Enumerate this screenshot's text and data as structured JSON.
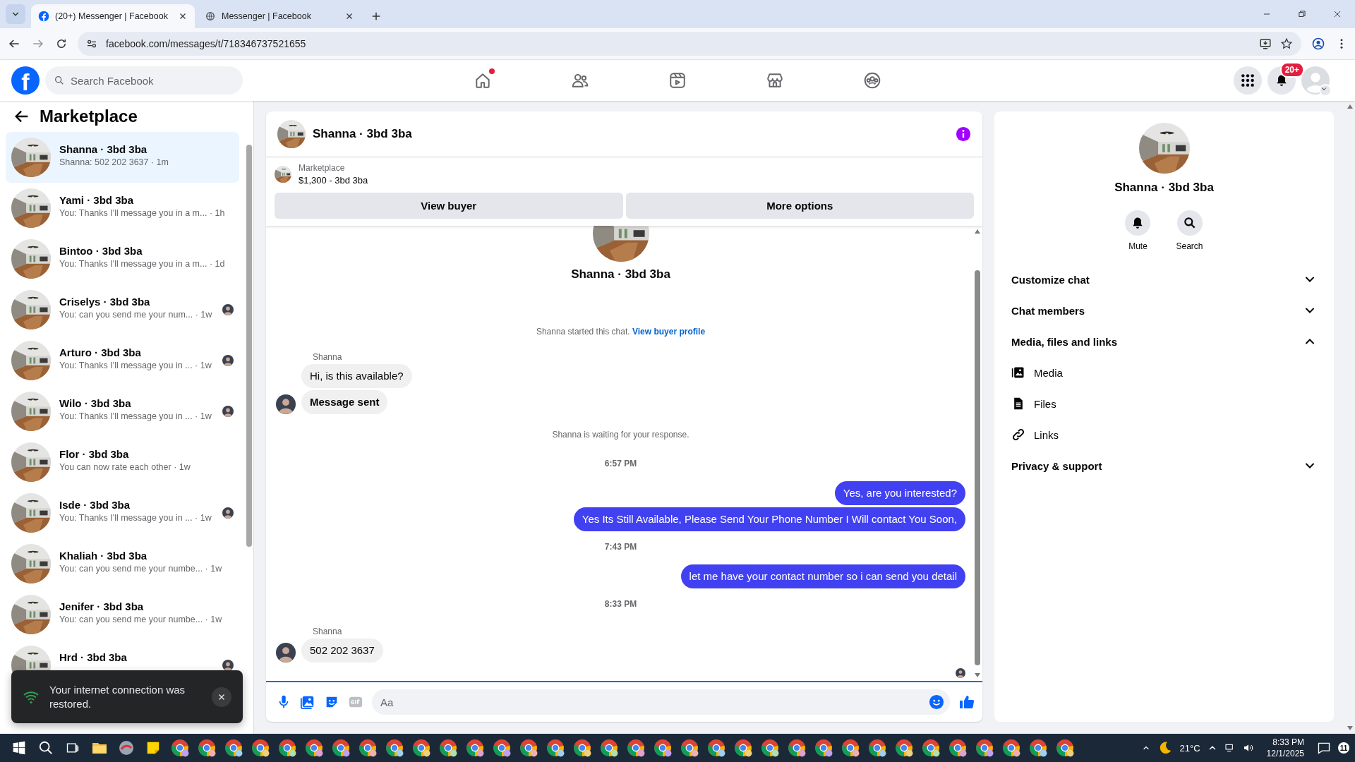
{
  "browser": {
    "tabs": [
      {
        "title": "(20+) Messenger | Facebook",
        "selected": true
      },
      {
        "title": "Messenger | Facebook",
        "selected": false
      }
    ],
    "url": "facebook.com/messages/t/718346737521655"
  },
  "header": {
    "logo": "f",
    "search": {
      "placeholder": "Search Facebook"
    },
    "nav": [
      {
        "kind": "home",
        "unread": true
      },
      {
        "kind": "friends",
        "unread": false
      },
      {
        "kind": "video",
        "unread": false
      },
      {
        "kind": "marketplace",
        "unread": false
      },
      {
        "kind": "groups",
        "unread": false
      }
    ],
    "notification_badge": "20+"
  },
  "sidebar": {
    "title": "Marketplace",
    "conversations": [
      {
        "name": "Shanna · 3bd 3ba",
        "preview": "Shanna: 502 202 3637 · 1m",
        "selected": true,
        "seen": false
      },
      {
        "name": "Yami · 3bd 3ba",
        "preview": "You: Thanks I'll message you in a m... · 1h",
        "selected": false,
        "seen": false
      },
      {
        "name": "Bintoo · 3bd 3ba",
        "preview": "You: Thanks I'll message you in a m... · 1d",
        "selected": false,
        "seen": false
      },
      {
        "name": "Criselys · 3bd 3ba",
        "preview": "You: can you send me your num... · 1w",
        "selected": false,
        "seen": true
      },
      {
        "name": "Arturo · 3bd 3ba",
        "preview": "You: Thanks I'll message you in ... · 1w",
        "selected": false,
        "seen": true
      },
      {
        "name": "Wilo · 3bd 3ba",
        "preview": "You: Thanks I'll message you in ... · 1w",
        "selected": false,
        "seen": true
      },
      {
        "name": "Flor · 3bd 3ba",
        "preview": "You can now rate each other · 1w",
        "selected": false,
        "seen": false
      },
      {
        "name": "Isde · 3bd 3ba",
        "preview": "You: Thanks I'll message you in ... · 1w",
        "selected": false,
        "seen": true
      },
      {
        "name": "Khaliah · 3bd 3ba",
        "preview": "You: can you send me your numbe... · 1w",
        "selected": false,
        "seen": false
      },
      {
        "name": "Jenifer · 3bd 3ba",
        "preview": "You: can you send me your numbe... · 1w",
        "selected": false,
        "seen": false
      },
      {
        "name": "Hrd · 3bd 3ba",
        "selected": false,
        "seen": true
      }
    ]
  },
  "toast": {
    "text": "Your internet connection was restored."
  },
  "chat": {
    "title": "Shanna · 3bd 3ba",
    "listing": {
      "label": "Marketplace",
      "item": "$1,300 - 3bd 3ba"
    },
    "buttons": [
      "View buyer",
      "More options"
    ],
    "profile_name": "Shanna · 3bd 3ba",
    "messages": [
      {
        "kind": "notice",
        "text": "Shanna started this chat.",
        "link": "View buyer profile"
      },
      {
        "kind": "sender",
        "text": "Shanna"
      },
      {
        "kind": "incoming",
        "text": "Hi, is this available?",
        "avatar": false,
        "bold": false
      },
      {
        "kind": "incoming",
        "text": "Message sent",
        "avatar": true,
        "bold": true
      },
      {
        "kind": "notice",
        "text": "Shanna is waiting for your response."
      },
      {
        "kind": "time",
        "text": "6:57 PM"
      },
      {
        "kind": "outgoing",
        "text": "Yes, are you interested?"
      },
      {
        "kind": "outgoing",
        "text": "Yes Its Still Available, Please Send Your Phone Number I Will contact You Soon,"
      },
      {
        "kind": "time",
        "text": "7:43 PM"
      },
      {
        "kind": "outgoing",
        "text": "let me have your contact number so i can send you detail"
      },
      {
        "kind": "time",
        "text": "8:33 PM"
      },
      {
        "kind": "sender",
        "text": "Shanna"
      },
      {
        "kind": "incoming",
        "text": "502 202 3637",
        "avatar": true,
        "bold": false
      },
      {
        "kind": "seen"
      }
    ],
    "composer": {
      "placeholder": "Aa"
    }
  },
  "info": {
    "name": "Shanna · 3bd 3ba",
    "actions": [
      {
        "kind": "mute",
        "label": "Mute"
      },
      {
        "kind": "search",
        "label": "Search"
      }
    ],
    "sections": [
      {
        "title": "Customize chat",
        "expanded": false
      },
      {
        "title": "Chat members",
        "expanded": false
      },
      {
        "title": "Media, files and links",
        "expanded": true,
        "children": [
          {
            "kind": "media",
            "label": "Media"
          },
          {
            "kind": "files",
            "label": "Files"
          },
          {
            "kind": "links",
            "label": "Links"
          }
        ]
      },
      {
        "title": "Privacy & support",
        "expanded": false
      }
    ]
  },
  "taskbar": {
    "weather": "21°C",
    "time": "8:33 PM",
    "date": "12/1/2025",
    "notifications": "11"
  }
}
